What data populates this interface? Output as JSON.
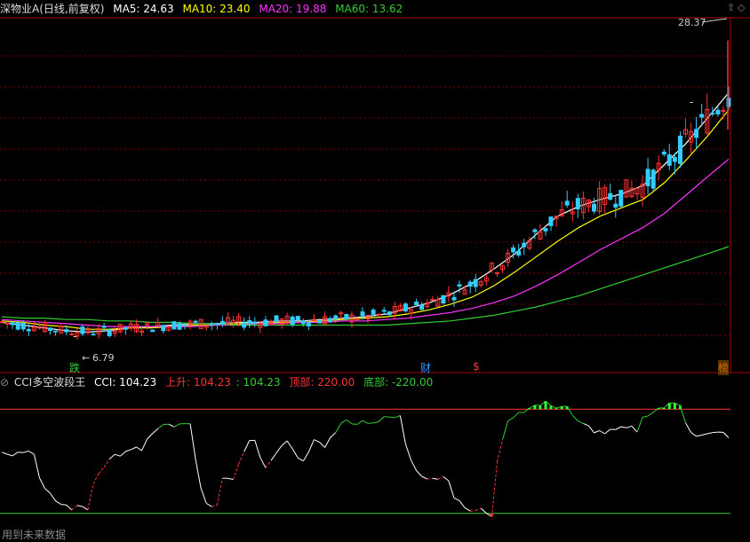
{
  "main_panel": {
    "title": "深物业A(日线,前复权)",
    "ma": [
      {
        "label": "MA5: 24.63",
        "color": "#ffffff"
      },
      {
        "label": "MA10: 23.40",
        "color": "#ffff00"
      },
      {
        "label": "MA20: 19.88",
        "color": "#ff33ff"
      },
      {
        "label": "MA60: 13.62",
        "color": "#33cc33"
      }
    ],
    "high_label": "28.37",
    "low_label": "6.79",
    "markers": [
      {
        "text": "跌",
        "color": "#33cc33"
      },
      {
        "text": "财",
        "color": "#3399ff"
      },
      {
        "text": "$",
        "color": "#ff3333"
      },
      {
        "text": "榜",
        "color": "#cc6600"
      }
    ],
    "dash_marks": [
      "-",
      "-",
      "-",
      "-",
      "-"
    ]
  },
  "indicator_panel": {
    "title": "CCI多空波段王",
    "values": [
      {
        "label": "CCI: 104.23",
        "color": "#ffffff"
      },
      {
        "label": "上升: 104.23",
        "color": "#ff3333"
      },
      {
        "label": ": 104.23",
        "color": "#33cc33"
      },
      {
        "label": "顶部: 220.00",
        "color": "#ff3333"
      },
      {
        "label": "底部: -220.00",
        "color": "#33cc33"
      }
    ],
    "footer": "用到未来数据"
  },
  "buttons": {
    "up_arrow": "⇧",
    "diamond": "◇",
    "collapse": "⊘"
  },
  "chart_data": [
    {
      "type": "candlestick",
      "price_range": [
        6.0,
        30.0
      ],
      "series": [
        {
          "name": "MA5",
          "values": [
            8.2,
            8.0,
            7.8,
            7.6,
            7.5,
            7.6,
            7.8,
            7.9,
            8.0,
            8.1,
            8.1,
            8.2,
            8.2,
            8.3,
            8.3,
            8.4,
            8.5,
            8.6,
            8.8,
            9.2,
            9.6,
            10.2,
            11.0,
            12.0,
            13.1,
            14.5,
            15.8,
            16.5,
            17.0,
            17.4,
            18.0,
            19.5,
            21.0,
            22.8,
            24.63
          ]
        },
        {
          "name": "MA10",
          "values": [
            8.3,
            8.2,
            8.0,
            7.9,
            7.7,
            7.7,
            7.8,
            7.8,
            7.9,
            8.0,
            8.0,
            8.1,
            8.1,
            8.2,
            8.2,
            8.3,
            8.4,
            8.5,
            8.6,
            8.8,
            9.1,
            9.5,
            10.0,
            10.8,
            11.8,
            12.9,
            14.0,
            15.0,
            15.8,
            16.4,
            17.0,
            18.2,
            19.8,
            21.5,
            23.4
          ]
        },
        {
          "name": "MA20",
          "values": [
            8.4,
            8.3,
            8.2,
            8.1,
            8.0,
            7.9,
            7.9,
            7.9,
            7.9,
            7.9,
            8.0,
            8.0,
            8.1,
            8.1,
            8.2,
            8.2,
            8.3,
            8.3,
            8.4,
            8.5,
            8.7,
            8.9,
            9.2,
            9.6,
            10.1,
            10.8,
            11.6,
            12.5,
            13.4,
            14.2,
            15.0,
            16.0,
            17.3,
            18.6,
            19.88
          ]
        },
        {
          "name": "MA60",
          "values": [
            8.6,
            8.5,
            8.5,
            8.4,
            8.4,
            8.3,
            8.3,
            8.2,
            8.2,
            8.1,
            8.1,
            8.0,
            8.0,
            8.0,
            8.0,
            8.0,
            8.0,
            8.0,
            8.0,
            8.1,
            8.2,
            8.3,
            8.5,
            8.7,
            9.0,
            9.3,
            9.7,
            10.1,
            10.6,
            11.1,
            11.6,
            12.1,
            12.6,
            13.1,
            13.62
          ]
        }
      ],
      "high": 28.37,
      "low": 6.79
    },
    {
      "type": "line",
      "name": "CCI",
      "ylim": [
        -300,
        300
      ],
      "thresholds": {
        "top": 220,
        "bottom": -220
      },
      "last": 104.23
    }
  ]
}
